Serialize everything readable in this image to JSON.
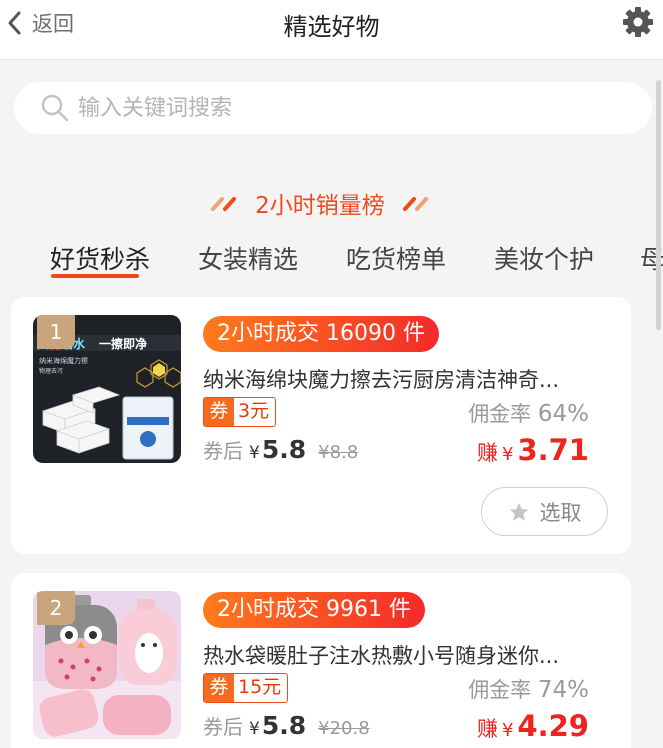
{
  "header": {
    "back_label": "返回",
    "title": "精选好物"
  },
  "search": {
    "placeholder": "输入关键词搜索"
  },
  "section": {
    "title": "2小时销量榜",
    "accent_color": "#f04a1a"
  },
  "tabs": [
    {
      "label": "好货秒杀",
      "active": true
    },
    {
      "label": "女装精选",
      "active": false
    },
    {
      "label": "吃货榜单",
      "active": false
    },
    {
      "label": "美妆个护",
      "active": false
    },
    {
      "label": "母",
      "active": false
    }
  ],
  "products": [
    {
      "rank": "1",
      "sales": "2小时成交 16090 件",
      "name": "纳米海绵块魔力擦去污厨房清洁神奇...",
      "coupon_tag": "券",
      "coupon_value": "3元",
      "commission_label": "佣金率",
      "commission_rate": "64%",
      "after_label": "券后",
      "currency": "¥",
      "after_price": "5.8",
      "original_price": "¥8.8",
      "earn_label": "赚",
      "earn_amount": "3.71",
      "select_label": "选取",
      "thumb_texts": [
        "只需沾水",
        "一擦即净",
        "纳米海绵魔力擦",
        "物理去污"
      ]
    },
    {
      "rank": "2",
      "sales": "2小时成交 9961 件",
      "name": "热水袋暖肚子注水热敷小号随身迷你...",
      "coupon_tag": "券",
      "coupon_value": "15元",
      "commission_label": "佣金率",
      "commission_rate": "74%",
      "after_label": "券后",
      "currency": "¥",
      "after_price": "5.8",
      "original_price": "¥20.8",
      "earn_label": "赚",
      "earn_amount": "4.29"
    }
  ]
}
